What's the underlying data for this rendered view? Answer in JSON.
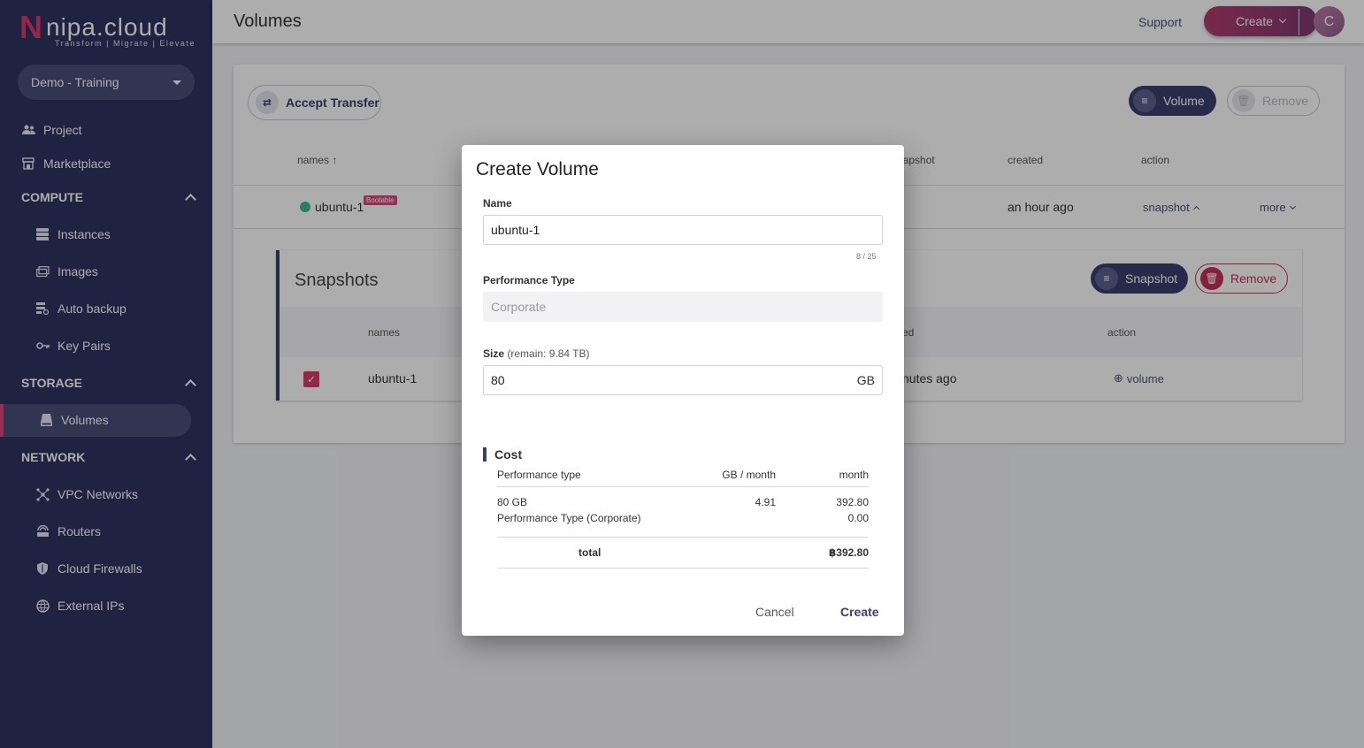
{
  "brand": {
    "mark": "N",
    "word": "nipa.cloud",
    "tagline": "Transform | Migrate | Elevate"
  },
  "project_select": {
    "value": "Demo - Training"
  },
  "sidebar": {
    "top_items": [
      {
        "label": "Project",
        "icon": "people-icon"
      },
      {
        "label": "Marketplace",
        "icon": "store-icon"
      }
    ],
    "sections": [
      {
        "title": "COMPUTE",
        "items": [
          "Instances",
          "Images",
          "Auto backup",
          "Key Pairs"
        ]
      },
      {
        "title": "STORAGE",
        "items": [
          "Volumes"
        ]
      },
      {
        "title": "NETWORK",
        "items": [
          "VPC Networks",
          "Routers",
          "Cloud Firewalls",
          "External IPs"
        ]
      }
    ],
    "active_item": "Volumes"
  },
  "topbar": {
    "title": "Volumes",
    "support": "Support",
    "create": "Create",
    "avatar_initial": "C"
  },
  "volumes": {
    "accept_transfer": "Accept Transfer",
    "volume_button": "Volume",
    "remove_button": "Remove",
    "columns": {
      "names": "names ↑",
      "snapshot": "napshot",
      "created": "created",
      "action": "action"
    },
    "row": {
      "name": "ubuntu-1",
      "badge": "Bootable",
      "created": "an hour ago",
      "action_snapshot": "snapshot",
      "action_more": "more"
    }
  },
  "snapshots": {
    "title": "Snapshots",
    "snapshot_button": "Snapshot",
    "remove_button": "Remove",
    "columns": {
      "names": "names",
      "created": "ed",
      "action": "action"
    },
    "row": {
      "name": "ubuntu-1",
      "created": "nutes ago",
      "action": "volume"
    }
  },
  "modal": {
    "title": "Create Volume",
    "name_label": "Name",
    "name_value": "ubuntu-1",
    "name_counter": "8 / 25",
    "perf_label": "Performance Type",
    "perf_value": "Corporate",
    "size_label": "Size",
    "size_remain": "(remain: 9.84 TB)",
    "size_value": "80",
    "size_unit": "GB",
    "cost": {
      "title": "Cost",
      "columns": [
        "Performance type",
        "GB / month",
        "month"
      ],
      "rows": [
        {
          "label": "80 GB",
          "per_gb": "4.91",
          "month": "392.80"
        },
        {
          "label": "Performance Type (Corporate)",
          "per_gb": "",
          "month": "0.00"
        }
      ],
      "total_label": "total",
      "total_value": "฿392.80"
    },
    "cancel": "Cancel",
    "create": "Create"
  },
  "colors": {
    "sidebar_bg": "#2e3360",
    "accent": "#d93a6a",
    "primary": "#3b3f6e",
    "status_ok": "#3bb79a"
  }
}
